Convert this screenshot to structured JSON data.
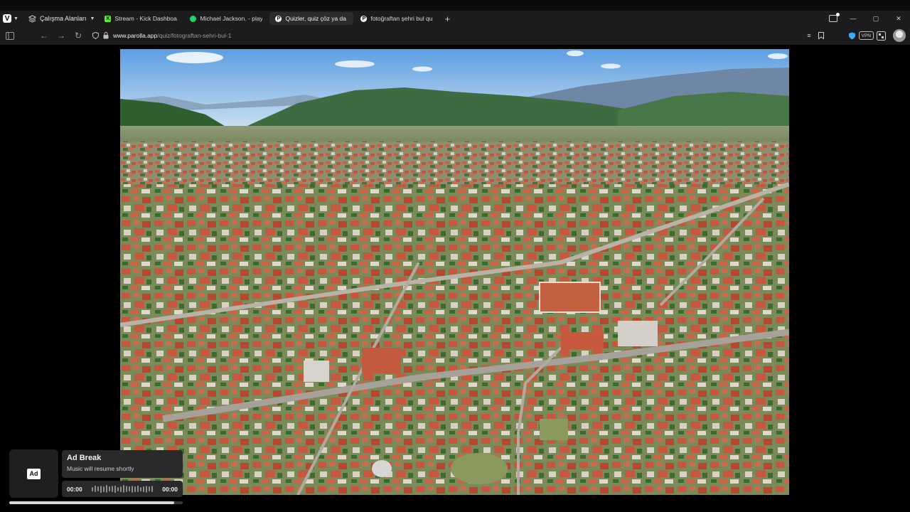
{
  "browser": {
    "workspaces_label": "Çalışma Alanları",
    "tabs": [
      {
        "title": "Stream - Kick Dashboard",
        "favicon": "kick-icon",
        "color": "#53fc18",
        "active": false
      },
      {
        "title": "Michael Jackson. - playlist by",
        "favicon": "spotify-icon",
        "color": "#1ed760",
        "active": false
      },
      {
        "title": "Quizler, quiz çöz ya da quiz",
        "favicon": "parolla-icon",
        "color": "#ffffff",
        "active": true
      },
      {
        "title": "fotoğraftan şehri bul quiz -",
        "favicon": "parolla-icon",
        "color": "#ffffff",
        "active": false
      }
    ],
    "url_host": "www.parolla.app",
    "url_path": "/quiz/fotograftan-sehri-bul-1",
    "vpn_label": "VPN"
  },
  "ad": {
    "badge": "Ad",
    "title": "Ad Break",
    "subtitle": "Music will resume shortly",
    "time_elapsed": "00:00",
    "time_total": "00:00",
    "progress": 0.95
  }
}
